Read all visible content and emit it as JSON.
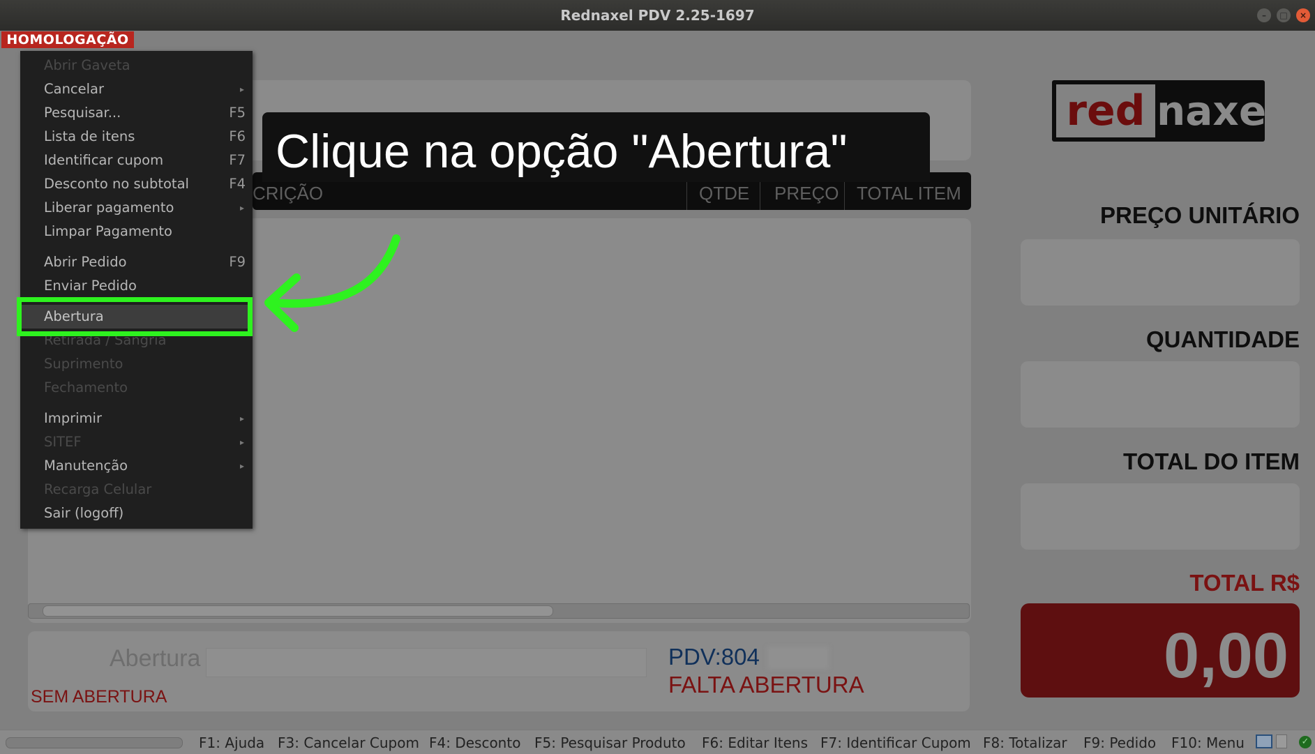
{
  "window": {
    "title": "Rednaxel PDV 2.25-1697",
    "badge": "HOMOLOGAÇÃO"
  },
  "logo": {
    "red": "red",
    "naxel": "naxel"
  },
  "grid": {
    "columns": [
      {
        "label": "CRIÇÃO"
      },
      {
        "label": "QTDE"
      },
      {
        "label": "PREÇO"
      },
      {
        "label": "TOTAL ITEM"
      }
    ]
  },
  "right_panel": {
    "unit_price_label": "PREÇO UNITÁRIO",
    "quantity_label": "QUANTIDADE",
    "item_total_label": "TOTAL DO ITEM",
    "total_label": "TOTAL R$",
    "total_value": "0,00"
  },
  "bottom": {
    "field_label": "Abertura",
    "field_value": "",
    "status_left": "SEM ABERTURA",
    "pdv": "PDV:804",
    "status_right": "FALTA ABERTURA"
  },
  "menu": {
    "items": [
      {
        "label": "Abrir Gaveta",
        "shortcut": "",
        "submenu": false,
        "disabled": true
      },
      {
        "label": "Cancelar",
        "shortcut": "",
        "submenu": true,
        "disabled": false
      },
      {
        "label": "Pesquisar...",
        "shortcut": "F5",
        "submenu": false,
        "disabled": false
      },
      {
        "label": "Lista de itens",
        "shortcut": "F6",
        "submenu": false,
        "disabled": false
      },
      {
        "label": "Identificar cupom",
        "shortcut": "F7",
        "submenu": false,
        "disabled": false
      },
      {
        "label": "Desconto no subtotal",
        "shortcut": "F4",
        "submenu": false,
        "disabled": false
      },
      {
        "label": "Liberar pagamento",
        "shortcut": "",
        "submenu": true,
        "disabled": false
      },
      {
        "label": "Limpar Pagamento",
        "shortcut": "",
        "submenu": false,
        "disabled": false
      },
      {
        "label": "Abrir Pedido",
        "shortcut": "F9",
        "submenu": false,
        "disabled": false
      },
      {
        "label": "Enviar Pedido",
        "shortcut": "",
        "submenu": false,
        "disabled": false
      },
      {
        "label": "Abertura",
        "shortcut": "",
        "submenu": false,
        "disabled": false,
        "selected": true
      },
      {
        "label": "Retirada / Sangria",
        "shortcut": "",
        "submenu": false,
        "disabled": true
      },
      {
        "label": "Suprimento",
        "shortcut": "",
        "submenu": false,
        "disabled": true
      },
      {
        "label": "Fechamento",
        "shortcut": "",
        "submenu": false,
        "disabled": true
      },
      {
        "label": "Imprimir",
        "shortcut": "",
        "submenu": true,
        "disabled": false
      },
      {
        "label": "SITEF",
        "shortcut": "",
        "submenu": true,
        "disabled": true
      },
      {
        "label": "Manutenção",
        "shortcut": "",
        "submenu": true,
        "disabled": false
      },
      {
        "label": "Recarga Celular",
        "shortcut": "",
        "submenu": false,
        "disabled": true
      },
      {
        "label": "Sair (logoff)",
        "shortcut": "",
        "submenu": false,
        "disabled": false
      }
    ]
  },
  "tutorial": {
    "instruction": "Clique na opção \"Abertura\"",
    "highlight_color": "#2ef21f"
  },
  "statusbar": {
    "shortcuts": [
      "F1: Ajuda",
      "F3: Cancelar Cupom",
      "F4: Desconto",
      "F5: Pesquisar Produto",
      "F6: Editar Itens",
      "F7: Identificar Cupom",
      "F8: Totalizar",
      "F9: Pedido",
      "F10: Menu"
    ]
  },
  "colors": {
    "badge": "#b8261f",
    "total_box": "#5e0f10",
    "status_red": "#7a1212",
    "pdv_blue": "#10305a"
  }
}
